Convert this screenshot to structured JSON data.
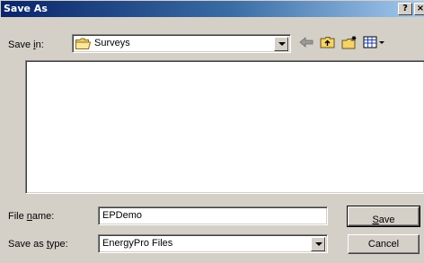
{
  "window": {
    "title": "Save As",
    "help_label": "?",
    "close_label": "×"
  },
  "save_in": {
    "label_pre": "Save ",
    "label_key": "i",
    "label_post": "n:",
    "value": "Surveys"
  },
  "toolbar": {
    "items": [
      "back-arrow-icon",
      "up-folder-icon",
      "new-folder-icon",
      "view-menu-icon"
    ]
  },
  "file_name": {
    "label_pre": "File ",
    "label_key": "n",
    "label_post": "ame:",
    "value": "EPDemo"
  },
  "save_as_type": {
    "label_pre": "Save as ",
    "label_key": "t",
    "label_post": "ype:",
    "value": "EnergyPro Files"
  },
  "buttons": {
    "save_pre": "",
    "save_key": "S",
    "save_post": "ave",
    "cancel": "Cancel"
  },
  "colors": {
    "face": "#d4d0c8",
    "title_start": "#0a246a",
    "title_end": "#a6caf0",
    "folder": "#f4d36b"
  }
}
